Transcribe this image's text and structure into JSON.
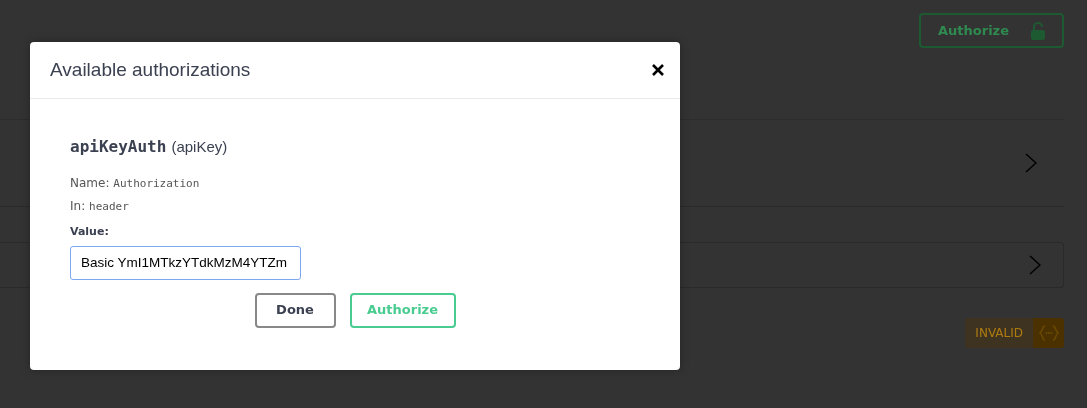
{
  "background": {
    "authorize_button": {
      "label": "Authorize"
    },
    "sections": [
      {
        "kind": "plain"
      },
      {
        "kind": "boxed"
      }
    ],
    "validator_badge": {
      "label": "INVALID"
    }
  },
  "modal": {
    "title": "Available authorizations",
    "scheme": {
      "name": "apiKeyAuth",
      "type": "(apiKey)"
    },
    "fields": [
      {
        "label": "Name:",
        "value": "Authorization"
      },
      {
        "label": "In:",
        "value": "header"
      }
    ],
    "value_label": "Value:",
    "value_input": {
      "value": "Basic YmI1MTkzYTdkMzM4YTZm"
    },
    "buttons": [
      {
        "label": "Done",
        "kind": "secondary"
      },
      {
        "label": "Authorize",
        "kind": "primary"
      }
    ]
  }
}
